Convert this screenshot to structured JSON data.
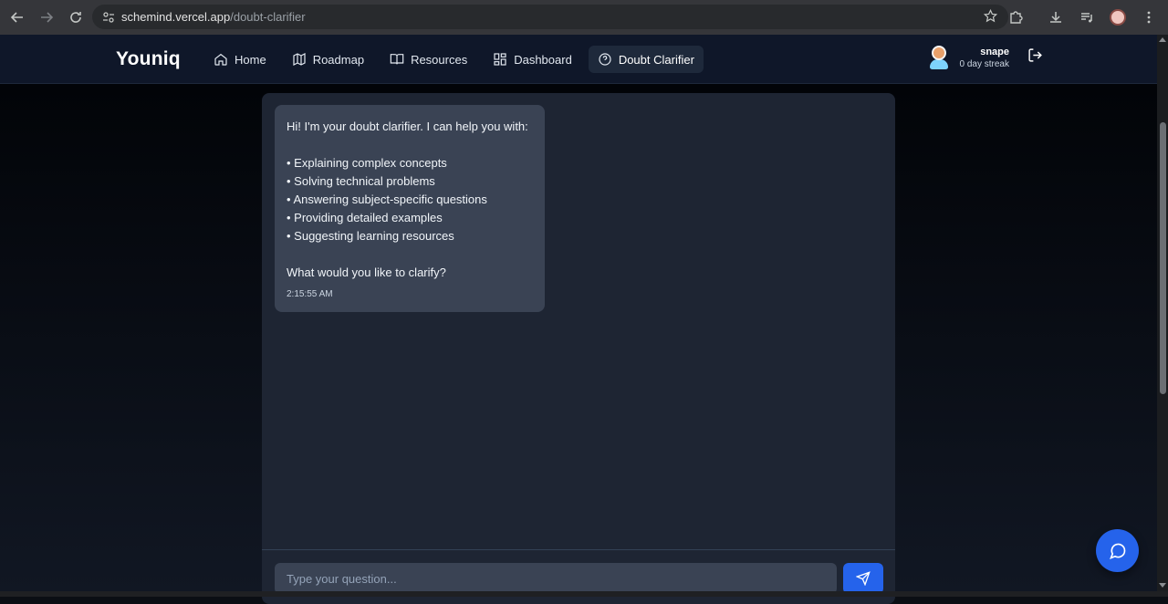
{
  "browser": {
    "url_host": "schemind.vercel.app",
    "url_path": "/doubt-clarifier"
  },
  "app": {
    "logo": "Youniq",
    "nav": [
      {
        "label": "Home",
        "icon": "home-icon"
      },
      {
        "label": "Roadmap",
        "icon": "map-icon"
      },
      {
        "label": "Resources",
        "icon": "book-icon"
      },
      {
        "label": "Dashboard",
        "icon": "grid-icon"
      },
      {
        "label": "Doubt Clarifier",
        "icon": "help-circle-icon",
        "active": true
      }
    ],
    "user": {
      "name": "snape",
      "streak": "0 day streak"
    }
  },
  "chat": {
    "message": {
      "lines": [
        "Hi! I'm your doubt clarifier. I can help you with:",
        "",
        "• Explaining complex concepts",
        "• Solving technical problems",
        "• Answering subject-specific questions",
        "• Providing detailed examples",
        "• Suggesting learning resources",
        "",
        "What would you like to clarify?"
      ],
      "time": "2:15:55 AM"
    },
    "input_placeholder": "Type your question..."
  },
  "colors": {
    "accent": "#2563eb",
    "panel": "#1e2533",
    "bubble": "#3a4354",
    "navbar": "#0f1729"
  }
}
